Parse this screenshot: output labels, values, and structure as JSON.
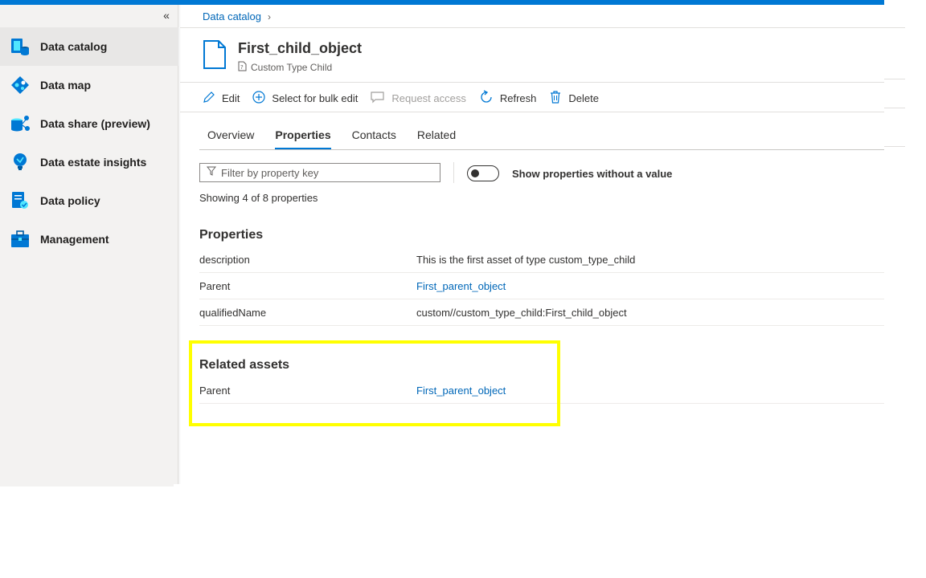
{
  "sidebar": {
    "collapse_glyph": "«",
    "items": [
      {
        "label": "Data catalog",
        "icon": "data-catalog-icon",
        "active": true
      },
      {
        "label": "Data map",
        "icon": "data-map-icon"
      },
      {
        "label": "Data share (preview)",
        "icon": "data-share-icon"
      },
      {
        "label": "Data estate insights",
        "icon": "insights-icon"
      },
      {
        "label": "Data policy",
        "icon": "data-policy-icon"
      },
      {
        "label": "Management",
        "icon": "management-icon"
      }
    ]
  },
  "breadcrumb": {
    "root": "Data catalog",
    "separator": "›"
  },
  "asset": {
    "title": "First_child_object",
    "type": "Custom Type Child"
  },
  "toolbar": {
    "edit": "Edit",
    "bulk_edit": "Select for bulk edit",
    "request_access": "Request access",
    "refresh": "Refresh",
    "delete": "Delete"
  },
  "tabs": [
    {
      "label": "Overview"
    },
    {
      "label": "Properties",
      "active": true
    },
    {
      "label": "Contacts"
    },
    {
      "label": "Related"
    }
  ],
  "filter": {
    "placeholder": "Filter by property key"
  },
  "toggle": {
    "label": "Show properties without a value",
    "on": false
  },
  "showing": "Showing 4 of 8 properties",
  "properties": {
    "title": "Properties",
    "rows": [
      {
        "key": "description",
        "value": "This is the first asset of type custom_type_child"
      },
      {
        "key": "Parent",
        "value": "First_parent_object"
      },
      {
        "key": "qualifiedName",
        "value": "custom//custom_type_child:First_child_object"
      }
    ]
  },
  "related_assets": {
    "title": "Related assets",
    "rows": [
      {
        "key": "Parent",
        "value": "First_parent_object"
      }
    ]
  },
  "colors": {
    "accent": "#0078d4",
    "link": "#0067b8",
    "highlight": "#ffff00"
  }
}
